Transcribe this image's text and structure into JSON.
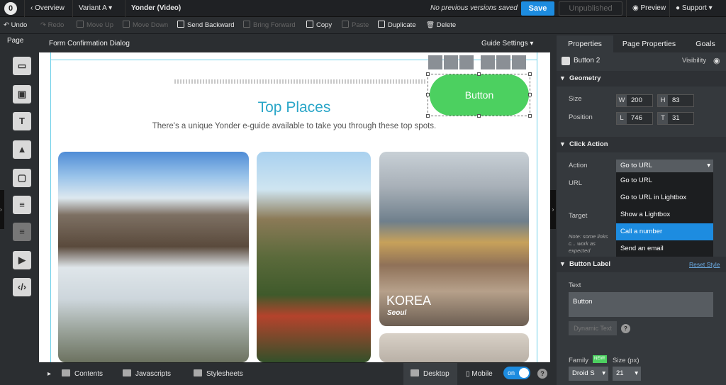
{
  "topbar": {
    "logo": "0",
    "overview": "Overview",
    "variant": "Variant A",
    "page_name": "Yonder (Video)",
    "versions_status": "No previous versions saved",
    "save": "Save",
    "unpublished": "Unpublished",
    "preview": "Preview",
    "support": "Support"
  },
  "toolbar": {
    "undo": "Undo",
    "redo": "Redo",
    "move_up": "Move Up",
    "move_down": "Move Down",
    "send_backward": "Send Backward",
    "bring_forward": "Bring Forward",
    "copy": "Copy",
    "paste": "Paste",
    "duplicate": "Duplicate",
    "delete": "Delete"
  },
  "left": {
    "page_tab": "Page",
    "rail_text_glyph": "T"
  },
  "canvas": {
    "header_title": "Form Confirmation Dialog",
    "guide_settings": "Guide Settings",
    "hero_title": "Top Places",
    "hero_subtitle": "There's a unique Yonder e-guide available to take you through these top spots.",
    "button_text": "Button",
    "card_title": "KOREA",
    "card_subtitle": "Seoul"
  },
  "bottombar": {
    "contents": "Contents",
    "javascripts": "Javascripts",
    "stylesheets": "Stylesheets",
    "desktop": "Desktop",
    "mobile": "Mobile",
    "toggle": "on",
    "help": "?"
  },
  "panel": {
    "tabs": [
      "Properties",
      "Page Properties",
      "Goals"
    ],
    "element_name": "Button 2",
    "visibility": "Visibility",
    "geometry": "Geometry",
    "size_label": "Size",
    "position_label": "Position",
    "w_key": "W",
    "w_val": "200",
    "h_key": "H",
    "h_val": "83",
    "l_key": "L",
    "l_val": "746",
    "t_key": "T",
    "t_val": "31",
    "click_action": "Click Action",
    "action_label": "Action",
    "action_value": "Go to URL",
    "url_label": "URL",
    "target_label": "Target",
    "note": "Note: some links c... work as expected",
    "action_options": [
      "Go to URL",
      "Go to URL in Lightbox",
      "Show a Lightbox",
      "Call a number",
      "Send an email"
    ],
    "button_label_section": "Button Label",
    "reset_style": "Reset Style",
    "text_label": "Text",
    "text_value": "Button",
    "dynamic_text": "Dynamic Text",
    "family_label": "Family",
    "new_badge": "NEW!",
    "size_px_label": "Size (px)",
    "family_value": "Droid S",
    "size_px_value": "21"
  },
  "colors": {
    "accent": "#1d8ce0",
    "cta_green": "#4cd060",
    "title_teal": "#2aa6c8"
  }
}
